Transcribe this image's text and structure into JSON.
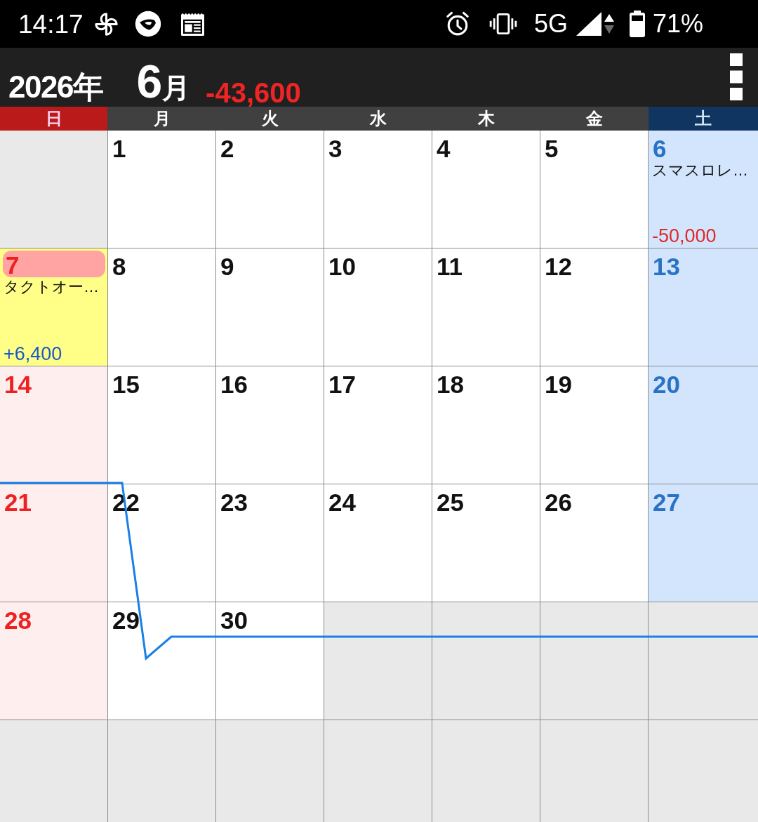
{
  "status_bar": {
    "time": "14:17",
    "network": "5G",
    "battery": "71%"
  },
  "header": {
    "year": "2026年",
    "month": {
      "number": "6",
      "unit": "月"
    },
    "total": {
      "text": "-43,600",
      "kind": "expense"
    }
  },
  "weekdays": [
    {
      "label": "日",
      "kind": "sunday"
    },
    {
      "label": "月",
      "kind": "weekday"
    },
    {
      "label": "火",
      "kind": "weekday"
    },
    {
      "label": "水",
      "kind": "weekday"
    },
    {
      "label": "木",
      "kind": "weekday"
    },
    {
      "label": "金",
      "kind": "weekday"
    },
    {
      "label": "土",
      "kind": "saturday"
    }
  ],
  "weeks": [
    [
      {
        "kind": "blank"
      },
      {
        "kind": "weekday",
        "day": "1",
        "selected": false,
        "today": false
      },
      {
        "kind": "weekday",
        "day": "2",
        "selected": false,
        "today": false
      },
      {
        "kind": "weekday",
        "day": "3",
        "selected": false,
        "today": false
      },
      {
        "kind": "weekday",
        "day": "4",
        "selected": false,
        "today": false
      },
      {
        "kind": "weekday",
        "day": "5",
        "selected": false,
        "today": false
      },
      {
        "kind": "saturday",
        "day": "6",
        "selected": false,
        "today": false,
        "event": "スマスロレ…",
        "amount": {
          "text": "-50,000",
          "kind": "expense"
        }
      }
    ],
    [
      {
        "kind": "sunday",
        "day": "7",
        "selected": true,
        "today": true,
        "event": "タクトオー…",
        "amount": {
          "text": "+6,400",
          "kind": "income"
        }
      },
      {
        "kind": "weekday",
        "day": "8",
        "selected": false,
        "today": false
      },
      {
        "kind": "weekday",
        "day": "9",
        "selected": false,
        "today": false
      },
      {
        "kind": "weekday",
        "day": "10",
        "selected": false,
        "today": false
      },
      {
        "kind": "weekday",
        "day": "11",
        "selected": false,
        "today": false
      },
      {
        "kind": "weekday",
        "day": "12",
        "selected": false,
        "today": false
      },
      {
        "kind": "saturday",
        "day": "13",
        "selected": false,
        "today": false
      }
    ],
    [
      {
        "kind": "sunday",
        "day": "14",
        "selected": false,
        "today": false
      },
      {
        "kind": "weekday",
        "day": "15",
        "selected": false,
        "today": false
      },
      {
        "kind": "weekday",
        "day": "16",
        "selected": false,
        "today": false
      },
      {
        "kind": "weekday",
        "day": "17",
        "selected": false,
        "today": false
      },
      {
        "kind": "weekday",
        "day": "18",
        "selected": false,
        "today": false
      },
      {
        "kind": "weekday",
        "day": "19",
        "selected": false,
        "today": false
      },
      {
        "kind": "saturday",
        "day": "20",
        "selected": false,
        "today": false
      }
    ],
    [
      {
        "kind": "sunday",
        "day": "21",
        "selected": false,
        "today": false
      },
      {
        "kind": "weekday",
        "day": "22",
        "selected": false,
        "today": false
      },
      {
        "kind": "weekday",
        "day": "23",
        "selected": false,
        "today": false
      },
      {
        "kind": "weekday",
        "day": "24",
        "selected": false,
        "today": false
      },
      {
        "kind": "weekday",
        "day": "25",
        "selected": false,
        "today": false
      },
      {
        "kind": "weekday",
        "day": "26",
        "selected": false,
        "today": false
      },
      {
        "kind": "saturday",
        "day": "27",
        "selected": false,
        "today": false
      }
    ],
    [
      {
        "kind": "sunday",
        "day": "28",
        "selected": false,
        "today": false
      },
      {
        "kind": "weekday",
        "day": "29",
        "selected": false,
        "today": false
      },
      {
        "kind": "weekday",
        "day": "30",
        "selected": false,
        "today": false
      },
      {
        "kind": "blank"
      },
      {
        "kind": "blank"
      },
      {
        "kind": "blank"
      },
      {
        "kind": "blank"
      }
    ],
    [
      {
        "kind": "blank"
      },
      {
        "kind": "blank"
      },
      {
        "kind": "blank"
      },
      {
        "kind": "blank"
      },
      {
        "kind": "blank"
      },
      {
        "kind": "blank"
      },
      {
        "kind": "blank"
      }
    ]
  ]
}
